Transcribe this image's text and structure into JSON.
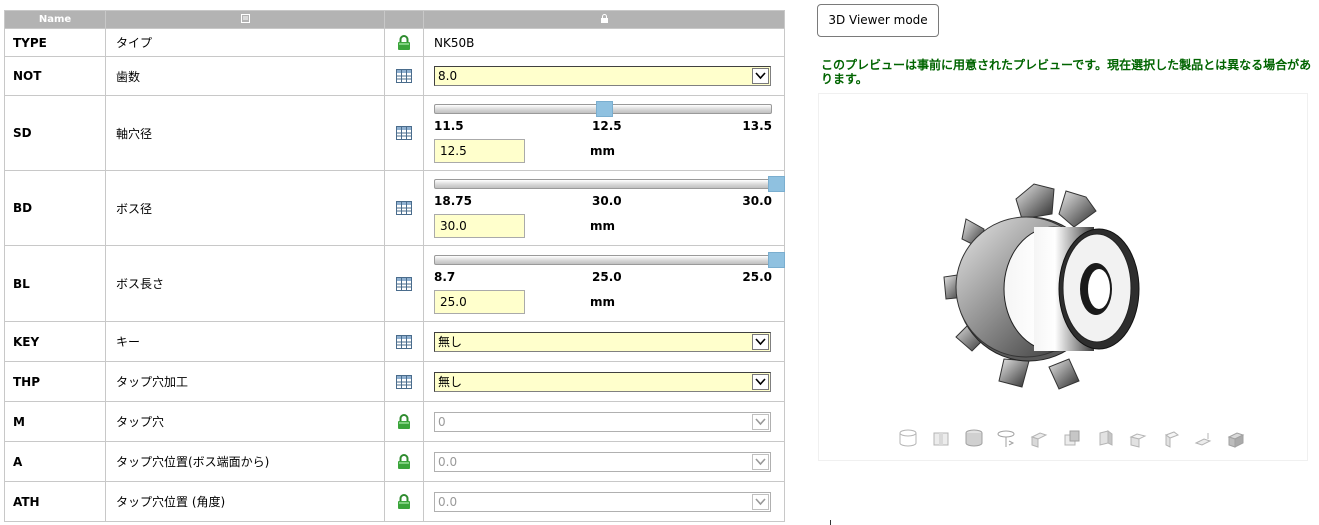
{
  "table": {
    "headers": {
      "name": "Name",
      "desc_icon": "edit-icon",
      "value_icon": "lock-header-icon"
    },
    "rows": [
      {
        "name": "TYPE",
        "desc": "タイプ",
        "icon": "lock-icon",
        "value": "NK50B"
      },
      {
        "name": "NOT",
        "desc": "歯数",
        "icon": "table-icon",
        "value": "8.0"
      },
      {
        "name": "SD",
        "desc": "軸穴径",
        "icon": "table-icon",
        "slider": {
          "min": "11.5",
          "mid": "12.5",
          "max": "13.5",
          "value": "12.5",
          "unit": "mm",
          "position": 0.5
        }
      },
      {
        "name": "BD",
        "desc": "ボス径",
        "icon": "table-icon",
        "slider": {
          "min": "18.75",
          "mid": "30.0",
          "max": "30.0",
          "value": "30.0",
          "unit": "mm",
          "position": 1.0
        }
      },
      {
        "name": "BL",
        "desc": "ボス長さ",
        "icon": "table-icon",
        "slider": {
          "min": "8.7",
          "mid": "25.0",
          "max": "25.0",
          "value": "25.0",
          "unit": "mm",
          "position": 1.0
        }
      },
      {
        "name": "KEY",
        "desc": "キー",
        "icon": "table-icon",
        "value": "無し"
      },
      {
        "name": "THP",
        "desc": "タップ穴加工",
        "icon": "table-icon",
        "value": "無し"
      },
      {
        "name": "M",
        "desc": "タップ穴",
        "icon": "lock-icon",
        "value": "0"
      },
      {
        "name": "A",
        "desc": "タップ穴位置(ボス端面から)",
        "icon": "lock-icon",
        "value": "0.0"
      },
      {
        "name": "ATH",
        "desc": "タップ穴位置 (角度)",
        "icon": "lock-icon",
        "value": "0.0"
      }
    ]
  },
  "viewer": {
    "button_label": "3D Viewer mode",
    "note": "このプレビューは事前に用意されたプレビューです。現在選択した製品とは異なる場合があります。",
    "toolbar_icons": [
      "view-iso-icon",
      "view-front-icon",
      "view-cylinder-icon",
      "rotate-icon",
      "view-top-icon",
      "view-side-icon",
      "view-right-icon",
      "view-back-icon",
      "view-left-icon",
      "view-bottom-icon",
      "view-solid-icon"
    ]
  }
}
